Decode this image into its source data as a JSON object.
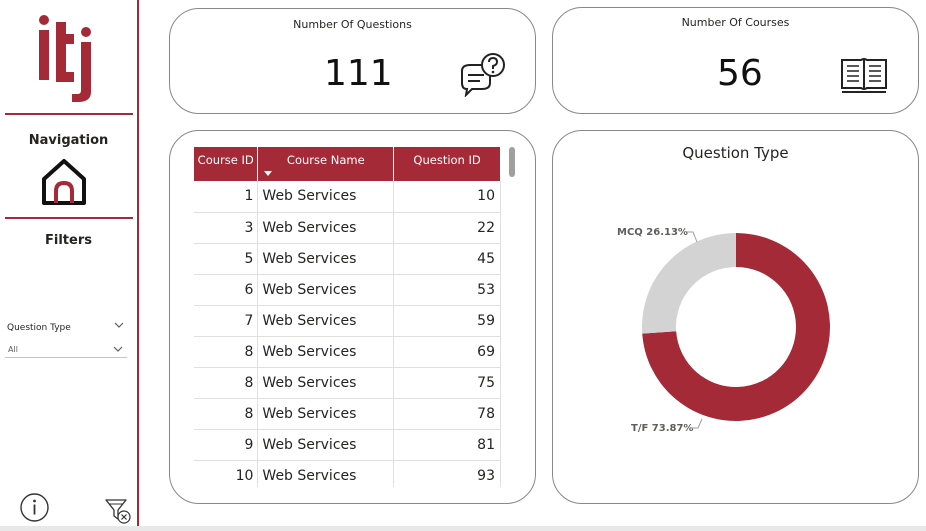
{
  "sidebar": {
    "logo_text": "iti",
    "navigation_label": "Navigation",
    "filters_label": "Filters",
    "slicer": {
      "label": "Question Type",
      "value": "All"
    }
  },
  "cards": {
    "questions": {
      "label": "Number Of Questions",
      "value": "111"
    },
    "courses": {
      "label": "Number Of Courses",
      "value": "56"
    }
  },
  "table": {
    "headers": [
      "Course ID",
      "Course Name",
      "Question ID"
    ],
    "rows": [
      [
        "1",
        "Web Services",
        "10"
      ],
      [
        "3",
        "Web Services",
        "22"
      ],
      [
        "5",
        "Web Services",
        "45"
      ],
      [
        "6",
        "Web Services",
        "53"
      ],
      [
        "7",
        "Web Services",
        "59"
      ],
      [
        "8",
        "Web Services",
        "69"
      ],
      [
        "8",
        "Web Services",
        "75"
      ],
      [
        "8",
        "Web Services",
        "78"
      ],
      [
        "9",
        "Web Services",
        "81"
      ],
      [
        "10",
        "Web Services",
        "93"
      ]
    ]
  },
  "chart_data": {
    "type": "pie",
    "title": "Question Type",
    "donut": true,
    "slices": [
      {
        "label": "T/F",
        "value": 73.87,
        "display": "T/F 73.87%",
        "color": "#a32a36"
      },
      {
        "label": "MCQ",
        "value": 26.13,
        "display": "MCQ 26.13%",
        "color": "#d3d3d3"
      }
    ]
  },
  "colors": {
    "accent": "#a32a36",
    "border": "#8a8886",
    "mcq": "#d3d3d3"
  }
}
